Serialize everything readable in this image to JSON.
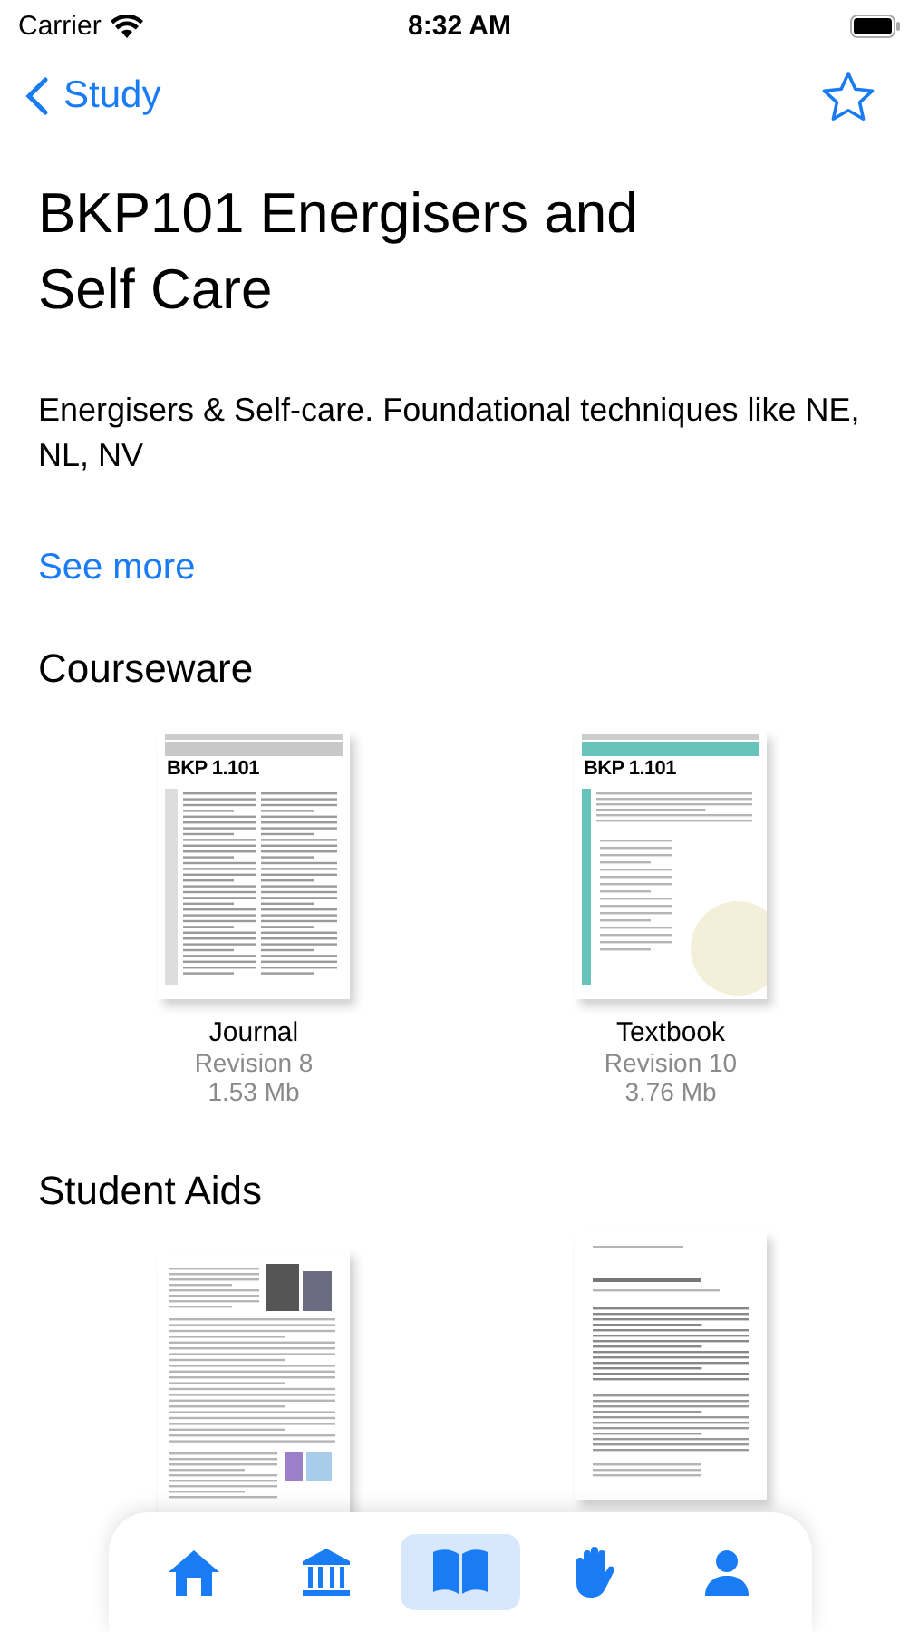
{
  "status_bar": {
    "carrier": "Carrier",
    "time": "8:32 AM"
  },
  "nav": {
    "back_label": "Study",
    "favorite": false
  },
  "title": "BKP101 Energisers and Self Care",
  "description": "Energisers & Self-care. Foundational techniques like NE, NL, NV",
  "see_more": "See more",
  "courseware": {
    "heading": "Courseware",
    "items": [
      {
        "kind": "plain",
        "cover_title": "BKP 1.101",
        "name": "Journal",
        "revision": "Revision 8",
        "size": "1.53 Mb"
      },
      {
        "kind": "banded",
        "cover_title": "BKP 1.101",
        "name": "Textbook",
        "revision": "Revision 10",
        "size": "3.76 Mb"
      }
    ]
  },
  "student_aids": {
    "heading": "Student Aids",
    "items": [
      {
        "kind": "profile"
      },
      {
        "kind": "paper"
      }
    ]
  },
  "tab_bar": [
    {
      "kind": "home",
      "selected": false
    },
    {
      "kind": "institution",
      "selected": false
    },
    {
      "kind": "book",
      "selected": true
    },
    {
      "kind": "hand",
      "selected": false
    },
    {
      "kind": "person",
      "selected": false
    }
  ]
}
